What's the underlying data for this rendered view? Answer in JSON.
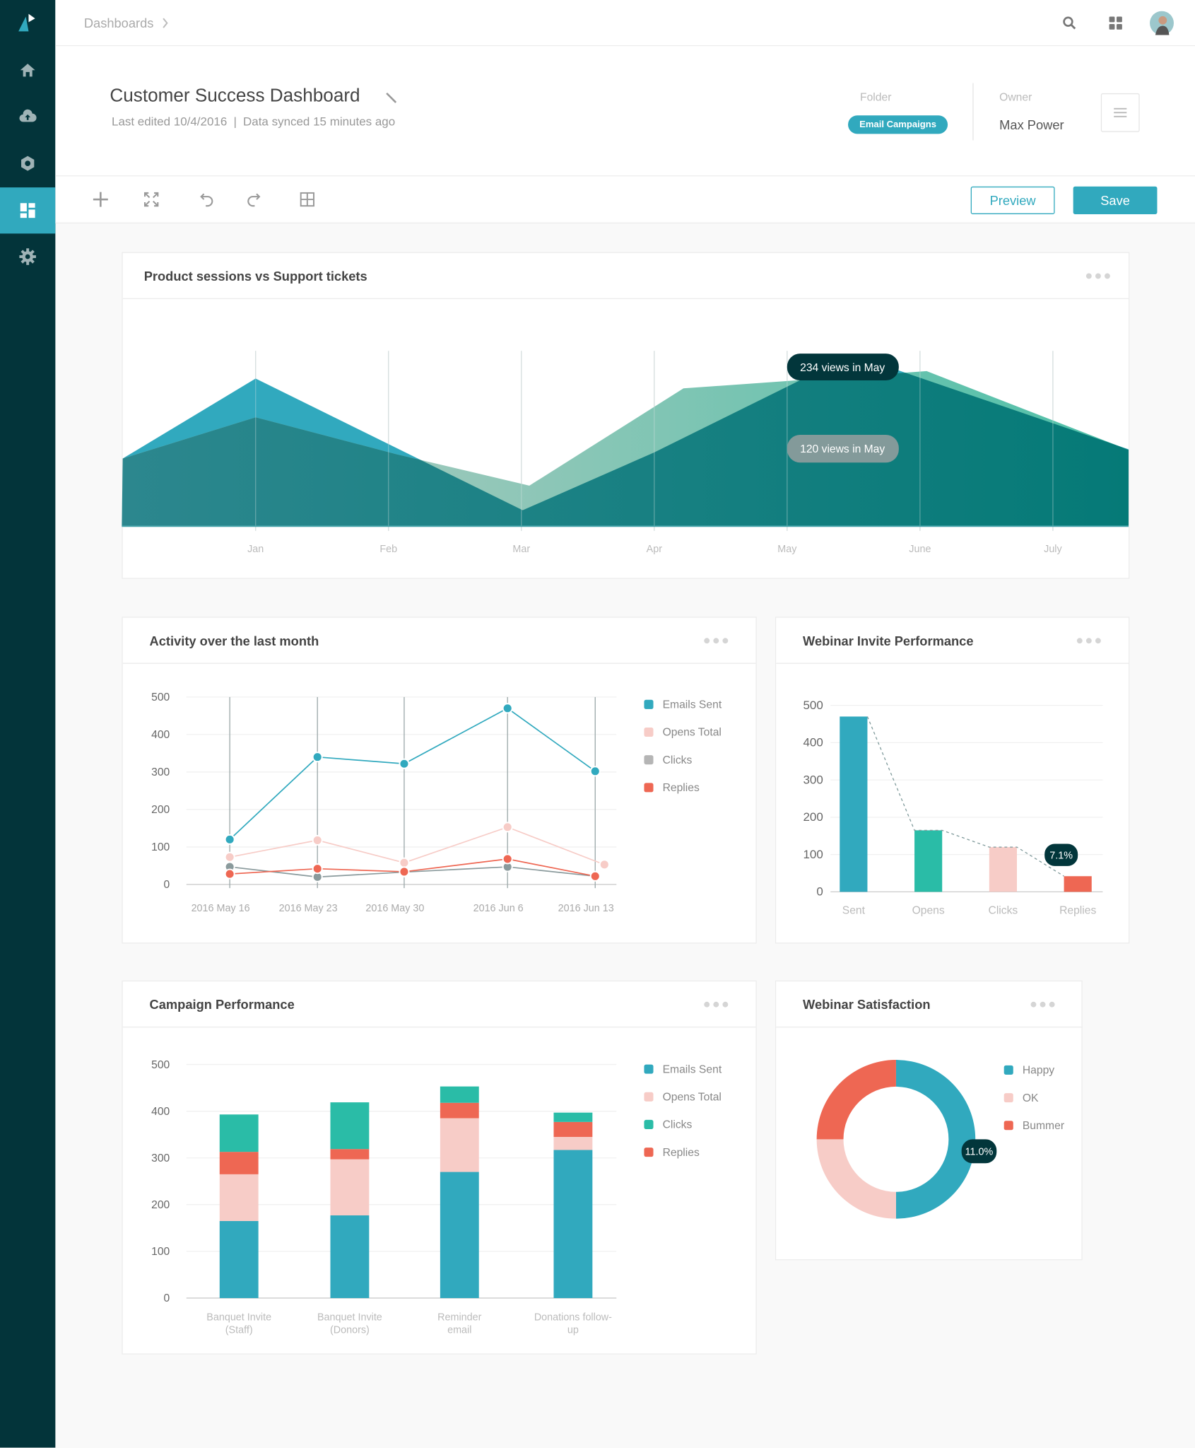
{
  "colors": {
    "sidebar": "#03343a",
    "accent": "#31a9be",
    "green": "#2abca7",
    "pink": "#f7ccc7",
    "red": "#ee6753",
    "grey": "#8a9a9c",
    "tooltip": "#02363b"
  },
  "sidebar": {
    "items": [
      {
        "icon": "logo-icon"
      },
      {
        "icon": "home-icon"
      },
      {
        "icon": "cloud-upload-icon"
      },
      {
        "icon": "settings-hex-icon"
      },
      {
        "icon": "dashboard-icon",
        "active": true
      },
      {
        "icon": "gear-icon"
      }
    ]
  },
  "topbar": {
    "breadcrumb": "Dashboards",
    "icons": [
      "search-icon",
      "apps-grid-icon",
      "avatar"
    ]
  },
  "header": {
    "title": "Customer Success Dashboard",
    "last_edited": "Last edited 10/4/2016",
    "separator": "|",
    "synced": "Data synced 15 minutes ago",
    "folder_label": "Folder",
    "folder_value": "Email Campaigns",
    "owner_label": "Owner",
    "owner_value": "Max Power"
  },
  "toolbar": {
    "icons": [
      "add-icon",
      "fullscreen-icon",
      "undo-icon",
      "redo-icon",
      "grid-layout-icon"
    ],
    "preview_label": "Preview",
    "save_label": "Save"
  },
  "cards": {
    "sessions": {
      "title": "Product sessions vs Support tickets"
    },
    "activity": {
      "title": "Activity over the last month"
    },
    "webinar": {
      "title": "Webinar Invite Performance"
    },
    "campaign": {
      "title": "Campaign Performance"
    },
    "satisfaction": {
      "title": "Webinar Satisfaction"
    }
  },
  "chart_data": [
    {
      "type": "area",
      "id": "sessions",
      "x_ticks": [
        "Jan",
        "Feb",
        "Mar",
        "Apr",
        "May",
        "June",
        "July"
      ],
      "series": [
        {
          "color": "#31a9be",
          "points": [
            [
              0,
              110
            ],
            [
              1,
              240
            ],
            [
              3.01,
              26
            ],
            [
              4,
              120
            ],
            [
              5.49,
              279
            ],
            [
              7.57,
              125
            ]
          ]
        },
        {
          "color": "#55c0a8",
          "points": [
            [
              0,
              110
            ],
            [
              1,
              177
            ],
            [
              2.06,
              117
            ],
            [
              3.06,
              66
            ],
            [
              4.22,
              224
            ],
            [
              6.05,
              252
            ],
            [
              7.57,
              124
            ]
          ]
        }
      ],
      "annotations": [
        "234 views in May",
        "120 views in May"
      ],
      "ylim": [
        0,
        300
      ],
      "grid": "vertical"
    },
    {
      "type": "line",
      "id": "activity",
      "categories": [
        "2016 May 16",
        "2016 May 23",
        "2016 May 30",
        "2016 Jun 6",
        "2016 Jun 13"
      ],
      "yticks": [
        "0",
        "100",
        "200",
        "300",
        "400",
        "500"
      ],
      "ylim": [
        0,
        500
      ],
      "legend": "right",
      "series": [
        {
          "name": "Emails Sent",
          "color": "#31a9be",
          "values": [
            120,
            340,
            322,
            470,
            302
          ]
        },
        {
          "name": "Opens Total",
          "color": "#f7ccc7",
          "values": [
            73,
            118,
            58,
            153,
            53
          ]
        },
        {
          "name": "Clicks",
          "color": "#8a9a9c",
          "legend_color": "#b5b5b5",
          "values": [
            47,
            20,
            33,
            47,
            22
          ]
        },
        {
          "name": "Replies",
          "color": "#ee6753",
          "values": [
            28,
            42,
            34,
            68,
            22
          ]
        }
      ]
    },
    {
      "type": "bar",
      "id": "webinar",
      "categories": [
        "Sent",
        "Opens",
        "Clicks",
        "Replies"
      ],
      "values": [
        470,
        165,
        120,
        42
      ],
      "colors": [
        "#31a9be",
        "#2abca7",
        "#f7ccc7",
        "#ee6753"
      ],
      "yticks": [
        "0",
        "100",
        "200",
        "300",
        "400",
        "500"
      ],
      "ylim": [
        0,
        500
      ],
      "annotation": "7.1%"
    },
    {
      "type": "bar",
      "stacked": true,
      "id": "campaign",
      "categories": [
        "Banquet Invite (Staff)",
        "Banquet Invite (Donors)",
        "Reminder email",
        "Donations follow-up"
      ],
      "yticks": [
        "0",
        "100",
        "200",
        "300",
        "400",
        "500"
      ],
      "ylim": [
        0,
        500
      ],
      "legend": "right",
      "series": [
        {
          "name": "Emails Sent",
          "color": "#31a9be",
          "values": [
            165,
            177,
            270,
            317
          ]
        },
        {
          "name": "Opens Total",
          "color": "#f7ccc7",
          "values": [
            100,
            120,
            115,
            28
          ]
        },
        {
          "name": "Replies",
          "color": "#ee6753",
          "values": [
            48,
            22,
            33,
            32
          ]
        },
        {
          "name": "Clicks",
          "color": "#2abca7",
          "values": [
            80,
            100,
            35,
            20
          ]
        }
      ],
      "legend_order": [
        "Emails Sent",
        "Opens Total",
        "Clicks",
        "Replies"
      ]
    },
    {
      "type": "pie",
      "id": "satisfaction",
      "donut": true,
      "slices": [
        {
          "name": "Happy",
          "value": 50,
          "color": "#31a9be"
        },
        {
          "name": "OK",
          "value": 25,
          "color": "#f7ccc7"
        },
        {
          "name": "Bummer",
          "value": 25,
          "color": "#ee6753"
        }
      ],
      "annotation": "11.0%",
      "legend": "right"
    }
  ]
}
